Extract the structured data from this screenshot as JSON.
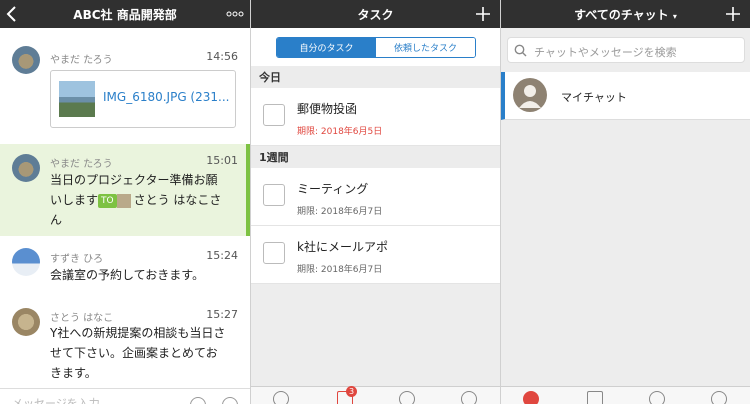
{
  "screen1": {
    "title": "ABC社 商品開発部",
    "messages": [
      {
        "sender": "やまだ たろう",
        "time": "14:56"
      },
      {
        "sender": "やまだ たろう",
        "time": "15:01",
        "text_line1": "当日のプロジェクター準備お願",
        "text_line2_pre": "いします",
        "to_label": "TO",
        "to_name": "さとう はなこさ",
        "text_line3": "ん"
      },
      {
        "sender": "すずき ひろ",
        "time": "15:24",
        "text": "会議室の予約しておきます。"
      },
      {
        "sender": "さとう はなこ",
        "time": "15:27",
        "line1": "Y社への新規提案の相談も当日さ",
        "line2": "せて下さい。企画案まとめてお",
        "line3": "きます。"
      }
    ],
    "file_name": "IMG_6180.JPG (231...",
    "input_placeholder": "メッセージを入力"
  },
  "screen2": {
    "title": "タスク",
    "seg_my": "自分のタスク",
    "seg_requested": "依頼したタスク",
    "section_today": "今日",
    "section_week": "1週間",
    "tasks": [
      {
        "title": "郵便物投函",
        "due": "期限: 2018年6月5日"
      },
      {
        "title": "ミーティング",
        "due": "期限: 2018年6月7日"
      },
      {
        "title": "k社にメールアポ",
        "due": "期限: 2018年6月7日"
      }
    ],
    "badge": "3"
  },
  "screen3": {
    "title": "すべてのチャット",
    "search_placeholder": "チャットやメッセージを検索",
    "chat_name": "マイチャット"
  },
  "colors": {
    "topbar": "#303030",
    "accent_blue": "#2a7fc9",
    "accent_green": "#7dc242",
    "due_red": "#e0473f"
  }
}
